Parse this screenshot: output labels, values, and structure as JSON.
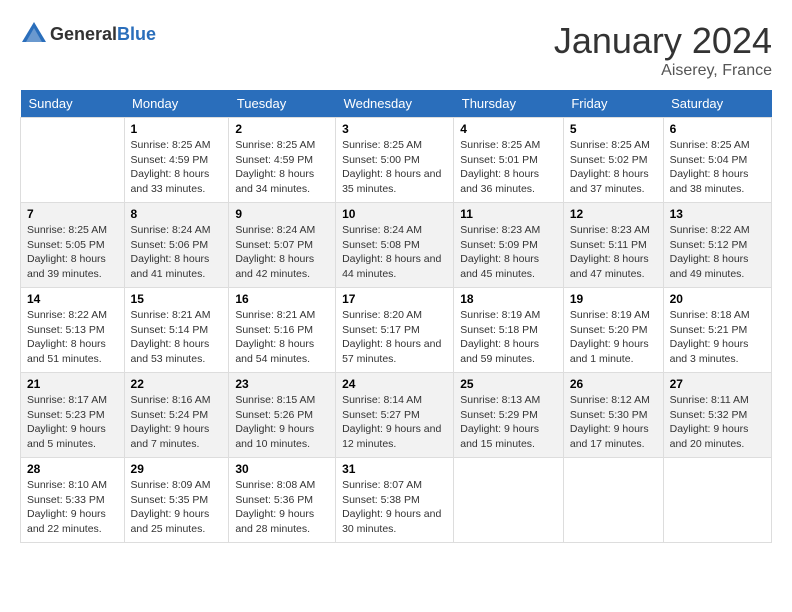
{
  "header": {
    "logo_general": "General",
    "logo_blue": "Blue",
    "month": "January 2024",
    "location": "Aiserey, France"
  },
  "days_of_week": [
    "Sunday",
    "Monday",
    "Tuesday",
    "Wednesday",
    "Thursday",
    "Friday",
    "Saturday"
  ],
  "weeks": [
    [
      {
        "day": "",
        "sunrise": "",
        "sunset": "",
        "daylight": "",
        "empty": true
      },
      {
        "day": "1",
        "sunrise": "Sunrise: 8:25 AM",
        "sunset": "Sunset: 4:59 PM",
        "daylight": "Daylight: 8 hours and 33 minutes."
      },
      {
        "day": "2",
        "sunrise": "Sunrise: 8:25 AM",
        "sunset": "Sunset: 4:59 PM",
        "daylight": "Daylight: 8 hours and 34 minutes."
      },
      {
        "day": "3",
        "sunrise": "Sunrise: 8:25 AM",
        "sunset": "Sunset: 5:00 PM",
        "daylight": "Daylight: 8 hours and 35 minutes."
      },
      {
        "day": "4",
        "sunrise": "Sunrise: 8:25 AM",
        "sunset": "Sunset: 5:01 PM",
        "daylight": "Daylight: 8 hours and 36 minutes."
      },
      {
        "day": "5",
        "sunrise": "Sunrise: 8:25 AM",
        "sunset": "Sunset: 5:02 PM",
        "daylight": "Daylight: 8 hours and 37 minutes."
      },
      {
        "day": "6",
        "sunrise": "Sunrise: 8:25 AM",
        "sunset": "Sunset: 5:04 PM",
        "daylight": "Daylight: 8 hours and 38 minutes."
      }
    ],
    [
      {
        "day": "7",
        "sunrise": "Sunrise: 8:25 AM",
        "sunset": "Sunset: 5:05 PM",
        "daylight": "Daylight: 8 hours and 39 minutes."
      },
      {
        "day": "8",
        "sunrise": "Sunrise: 8:24 AM",
        "sunset": "Sunset: 5:06 PM",
        "daylight": "Daylight: 8 hours and 41 minutes."
      },
      {
        "day": "9",
        "sunrise": "Sunrise: 8:24 AM",
        "sunset": "Sunset: 5:07 PM",
        "daylight": "Daylight: 8 hours and 42 minutes."
      },
      {
        "day": "10",
        "sunrise": "Sunrise: 8:24 AM",
        "sunset": "Sunset: 5:08 PM",
        "daylight": "Daylight: 8 hours and 44 minutes."
      },
      {
        "day": "11",
        "sunrise": "Sunrise: 8:23 AM",
        "sunset": "Sunset: 5:09 PM",
        "daylight": "Daylight: 8 hours and 45 minutes."
      },
      {
        "day": "12",
        "sunrise": "Sunrise: 8:23 AM",
        "sunset": "Sunset: 5:11 PM",
        "daylight": "Daylight: 8 hours and 47 minutes."
      },
      {
        "day": "13",
        "sunrise": "Sunrise: 8:22 AM",
        "sunset": "Sunset: 5:12 PM",
        "daylight": "Daylight: 8 hours and 49 minutes."
      }
    ],
    [
      {
        "day": "14",
        "sunrise": "Sunrise: 8:22 AM",
        "sunset": "Sunset: 5:13 PM",
        "daylight": "Daylight: 8 hours and 51 minutes."
      },
      {
        "day": "15",
        "sunrise": "Sunrise: 8:21 AM",
        "sunset": "Sunset: 5:14 PM",
        "daylight": "Daylight: 8 hours and 53 minutes."
      },
      {
        "day": "16",
        "sunrise": "Sunrise: 8:21 AM",
        "sunset": "Sunset: 5:16 PM",
        "daylight": "Daylight: 8 hours and 54 minutes."
      },
      {
        "day": "17",
        "sunrise": "Sunrise: 8:20 AM",
        "sunset": "Sunset: 5:17 PM",
        "daylight": "Daylight: 8 hours and 57 minutes."
      },
      {
        "day": "18",
        "sunrise": "Sunrise: 8:19 AM",
        "sunset": "Sunset: 5:18 PM",
        "daylight": "Daylight: 8 hours and 59 minutes."
      },
      {
        "day": "19",
        "sunrise": "Sunrise: 8:19 AM",
        "sunset": "Sunset: 5:20 PM",
        "daylight": "Daylight: 9 hours and 1 minute."
      },
      {
        "day": "20",
        "sunrise": "Sunrise: 8:18 AM",
        "sunset": "Sunset: 5:21 PM",
        "daylight": "Daylight: 9 hours and 3 minutes."
      }
    ],
    [
      {
        "day": "21",
        "sunrise": "Sunrise: 8:17 AM",
        "sunset": "Sunset: 5:23 PM",
        "daylight": "Daylight: 9 hours and 5 minutes."
      },
      {
        "day": "22",
        "sunrise": "Sunrise: 8:16 AM",
        "sunset": "Sunset: 5:24 PM",
        "daylight": "Daylight: 9 hours and 7 minutes."
      },
      {
        "day": "23",
        "sunrise": "Sunrise: 8:15 AM",
        "sunset": "Sunset: 5:26 PM",
        "daylight": "Daylight: 9 hours and 10 minutes."
      },
      {
        "day": "24",
        "sunrise": "Sunrise: 8:14 AM",
        "sunset": "Sunset: 5:27 PM",
        "daylight": "Daylight: 9 hours and 12 minutes."
      },
      {
        "day": "25",
        "sunrise": "Sunrise: 8:13 AM",
        "sunset": "Sunset: 5:29 PM",
        "daylight": "Daylight: 9 hours and 15 minutes."
      },
      {
        "day": "26",
        "sunrise": "Sunrise: 8:12 AM",
        "sunset": "Sunset: 5:30 PM",
        "daylight": "Daylight: 9 hours and 17 minutes."
      },
      {
        "day": "27",
        "sunrise": "Sunrise: 8:11 AM",
        "sunset": "Sunset: 5:32 PM",
        "daylight": "Daylight: 9 hours and 20 minutes."
      }
    ],
    [
      {
        "day": "28",
        "sunrise": "Sunrise: 8:10 AM",
        "sunset": "Sunset: 5:33 PM",
        "daylight": "Daylight: 9 hours and 22 minutes."
      },
      {
        "day": "29",
        "sunrise": "Sunrise: 8:09 AM",
        "sunset": "Sunset: 5:35 PM",
        "daylight": "Daylight: 9 hours and 25 minutes."
      },
      {
        "day": "30",
        "sunrise": "Sunrise: 8:08 AM",
        "sunset": "Sunset: 5:36 PM",
        "daylight": "Daylight: 9 hours and 28 minutes."
      },
      {
        "day": "31",
        "sunrise": "Sunrise: 8:07 AM",
        "sunset": "Sunset: 5:38 PM",
        "daylight": "Daylight: 9 hours and 30 minutes."
      },
      {
        "day": "",
        "sunrise": "",
        "sunset": "",
        "daylight": "",
        "empty": true
      },
      {
        "day": "",
        "sunrise": "",
        "sunset": "",
        "daylight": "",
        "empty": true
      },
      {
        "day": "",
        "sunrise": "",
        "sunset": "",
        "daylight": "",
        "empty": true
      }
    ]
  ]
}
